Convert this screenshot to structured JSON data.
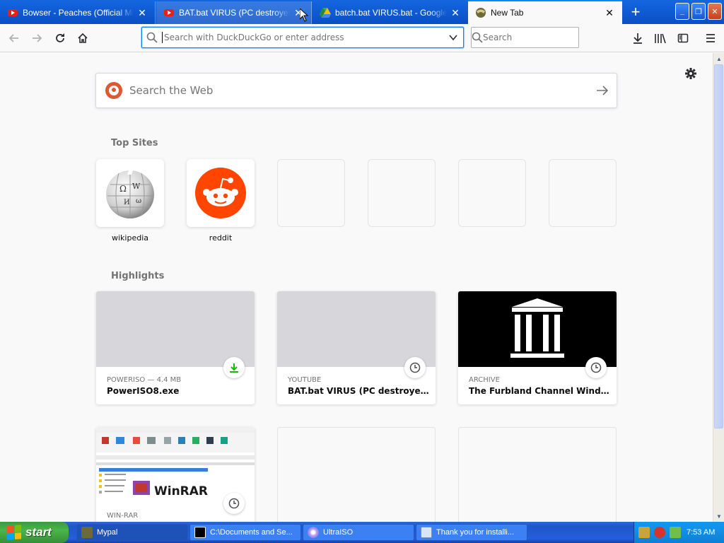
{
  "tabs": [
    {
      "title": "Bowser - Peaches (Official Music V",
      "favicon": "youtube-icon",
      "close": "✕"
    },
    {
      "title": "BAT.bat VIRUS (PC destroyer) +D",
      "favicon": "youtube-icon",
      "close": "✕"
    },
    {
      "title": "batch.bat VIRUS.bat - Google Dr",
      "favicon": "google-drive-icon",
      "close": "✕"
    },
    {
      "title": "New Tab",
      "favicon": "firefox-newtab-icon",
      "close": "✕"
    }
  ],
  "newtab_glyph": "+",
  "window": {
    "minimize": "_",
    "restore": "❐",
    "close": "✕"
  },
  "toolbar": {
    "url_placeholder": "Search with DuckDuckGo or enter address",
    "search_placeholder": "Search"
  },
  "newtab": {
    "websearch_placeholder": "Search the Web",
    "top_sites_title": "Top Sites",
    "top_sites": [
      {
        "label": "wikipedia",
        "icon": "wikipedia-globe-icon"
      },
      {
        "label": "reddit",
        "icon": "reddit-alien-icon"
      },
      {
        "label": "",
        "icon": ""
      },
      {
        "label": "",
        "icon": ""
      },
      {
        "label": "",
        "icon": ""
      },
      {
        "label": "",
        "icon": ""
      }
    ],
    "highlights_title": "Highlights",
    "highlights": [
      {
        "context": "POWERISO — 4.4 MB",
        "title": "PowerISO8.exe",
        "badge": "download-icon"
      },
      {
        "context": "YOUTUBE",
        "title": "BAT.bat VIRUS (PC destroyer) +D…",
        "badge": "clock-icon"
      },
      {
        "context": "ARCHIVE",
        "title": "The Furbland Channel Windows…",
        "badge": "clock-icon"
      },
      {
        "context": "WIN-RAR",
        "title": "",
        "badge": "clock-icon",
        "preview_text": "WinRAR"
      }
    ]
  },
  "taskbar": {
    "start_label": "start",
    "tasks": [
      {
        "label": "Mypal",
        "icon": "mypal-icon"
      },
      {
        "label": "C:\\Documents and Se...",
        "icon": "7zip-icon"
      },
      {
        "label": "UltraISO",
        "icon": "ultraiso-disc-icon"
      },
      {
        "label": "Thank you for installi...",
        "icon": "installer-icon"
      }
    ],
    "clock": "7:53 AM"
  },
  "colors": {
    "tabstrip": "#0b5cd7",
    "accent": "#0a84ff",
    "reddit": "#ff4500",
    "download_green": "#12bc00"
  }
}
